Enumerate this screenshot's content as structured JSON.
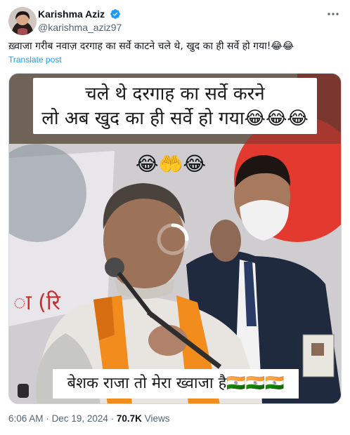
{
  "author": {
    "display_name": "Karishma Aziz",
    "handle": "@karishma_aziz97",
    "verified": true
  },
  "tweet": {
    "text": "ख़्वाजा गरीब नवाज़ दरगाह का सर्वे काटने चले थे, खुद का ही सर्वे हो गया!😂😂",
    "translate_label": "Translate post"
  },
  "media": {
    "caption_top_line1": "चले थे दरगाह का सर्वे करने",
    "caption_top_line2": "लो अब खुद का ही सर्वे हो गया😂😂😂",
    "caption_bottom": "बेशक राजा तो मेरा ख्वाजा है🇮🇳🇮🇳🇮🇳",
    "overlay_emojis": "😂🤲😂"
  },
  "meta": {
    "time": "6:06 AM",
    "separator": "·",
    "date": "Dec 19, 2024",
    "views_count": "70.7K",
    "views_label": "Views"
  },
  "colors": {
    "link": "#1d9bf0",
    "verified": "#1d9bf0",
    "secondary_text": "#536471"
  },
  "icons": [
    "verified-badge-icon",
    "more-options-icon",
    "loading-spinner-icon"
  ]
}
